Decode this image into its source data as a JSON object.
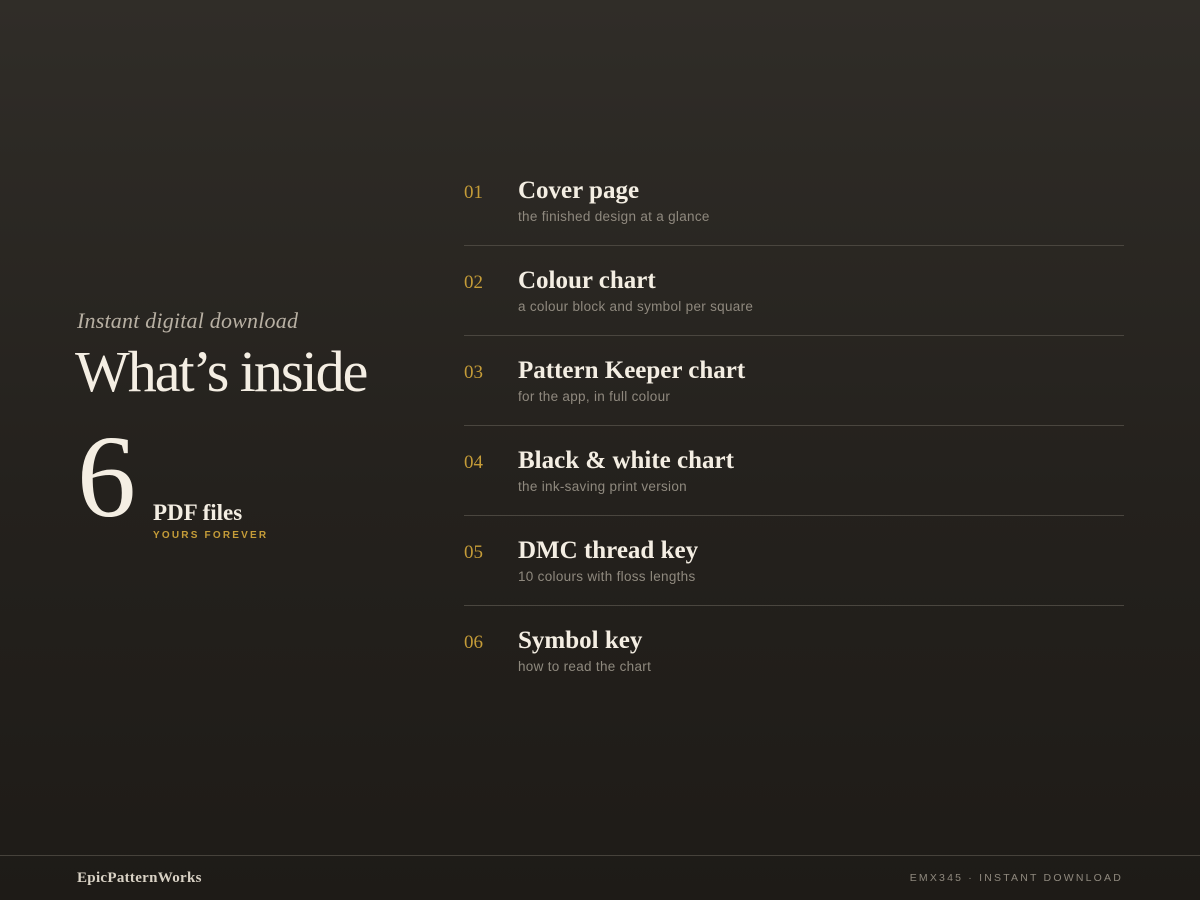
{
  "intro": {
    "subtitle": "Instant digital download",
    "headline": "What’s inside",
    "count": "6",
    "count_label": "PDF files",
    "count_tag": "YOURS FOREVER"
  },
  "files": [
    {
      "num": "01",
      "title": "Cover page",
      "desc": "the finished design at a glance"
    },
    {
      "num": "02",
      "title": "Colour chart",
      "desc": "a colour block and symbol per square"
    },
    {
      "num": "03",
      "title": "Pattern Keeper chart",
      "desc": "for the app, in full colour"
    },
    {
      "num": "04",
      "title": "Black & white chart",
      "desc": "the ink-saving print version"
    },
    {
      "num": "05",
      "title": "DMC thread key",
      "desc": "10 colours with floss lengths"
    },
    {
      "num": "06",
      "title": "Symbol key",
      "desc": "how to read the chart"
    }
  ],
  "footer": {
    "brand": "EpicPatternWorks",
    "sku": "EMX345 · INSTANT DOWNLOAD"
  },
  "colors": {
    "accent": "#c59c38",
    "background": "#2a2722",
    "text": "#f4eee3",
    "muted": "#8f897e"
  }
}
